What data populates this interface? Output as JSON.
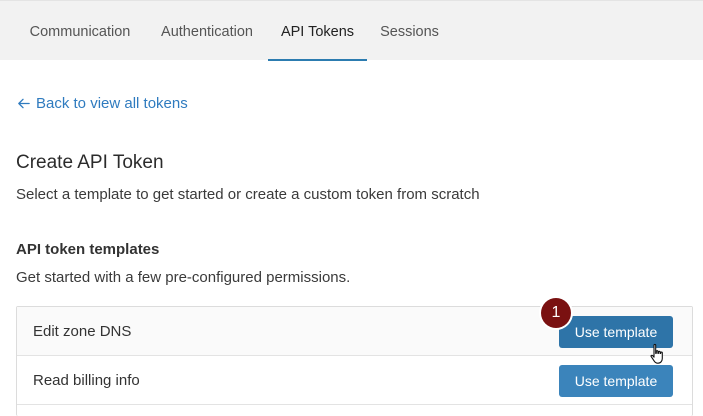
{
  "tabs": [
    {
      "label": "Communication",
      "active": false
    },
    {
      "label": "Authentication",
      "active": false
    },
    {
      "label": "API Tokens",
      "active": true
    },
    {
      "label": "Sessions",
      "active": false
    }
  ],
  "back_link": {
    "label": "Back to view all tokens",
    "icon": "arrow-left-icon"
  },
  "page": {
    "title": "Create API Token",
    "subtitle": "Select a template to get started or create a custom token from scratch"
  },
  "templates_section": {
    "title": "API token templates",
    "subtitle": "Get started with a few pre-configured permissions.",
    "items": [
      {
        "name": "Edit zone DNS",
        "button_label": "Use template"
      },
      {
        "name": "Read billing info",
        "button_label": "Use template"
      }
    ]
  },
  "annotation": {
    "step_number": "1"
  },
  "colors": {
    "accent": "#2c7cb0",
    "button": "#2e74a8",
    "link": "#2f7bbf",
    "badge": "#7a1111"
  }
}
